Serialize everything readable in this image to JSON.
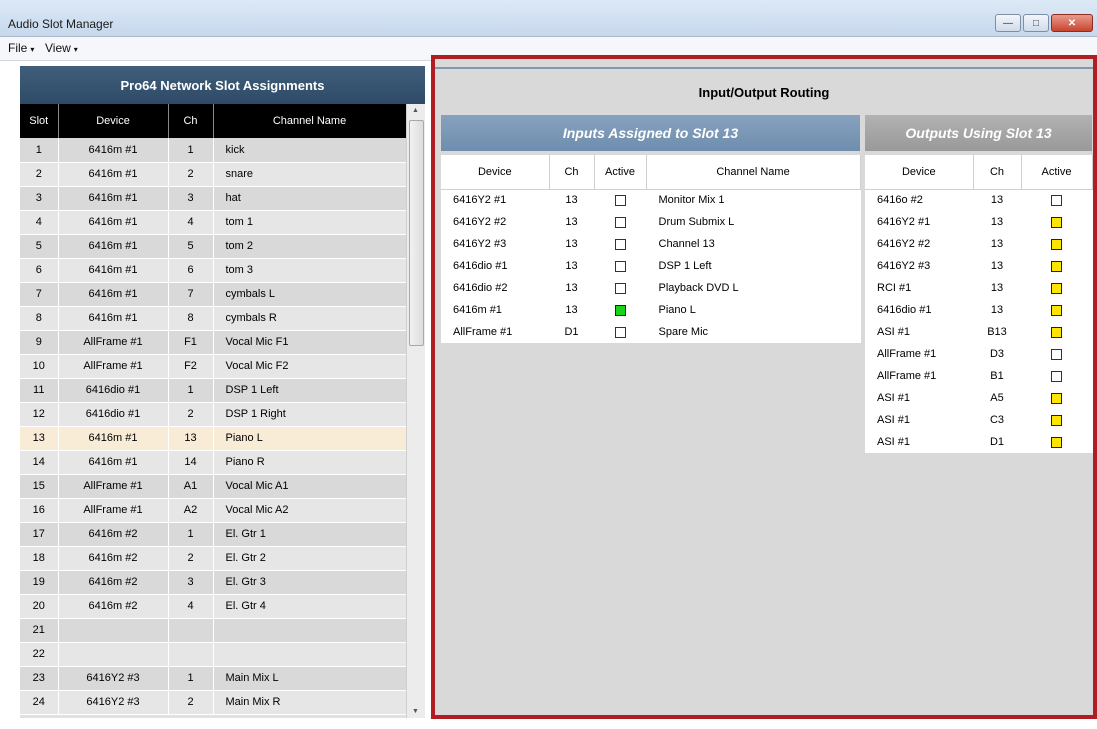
{
  "window": {
    "title": "Audio Slot Manager",
    "min": "—",
    "max": "□",
    "close": "✕"
  },
  "menu": [
    {
      "label": "File",
      "arrow": "▾"
    },
    {
      "label": "View",
      "arrow": "▾"
    }
  ],
  "slots": {
    "title": "Pro64 Network Slot Assignments",
    "columns": [
      "Slot",
      "Device",
      "Ch",
      "Channel Name"
    ],
    "rows": [
      {
        "slot": "1",
        "device": "6416m #1",
        "ch": "1",
        "name": "kick"
      },
      {
        "slot": "2",
        "device": "6416m #1",
        "ch": "2",
        "name": "snare"
      },
      {
        "slot": "3",
        "device": "6416m #1",
        "ch": "3",
        "name": "hat"
      },
      {
        "slot": "4",
        "device": "6416m #1",
        "ch": "4",
        "name": "tom 1"
      },
      {
        "slot": "5",
        "device": "6416m #1",
        "ch": "5",
        "name": "tom 2"
      },
      {
        "slot": "6",
        "device": "6416m #1",
        "ch": "6",
        "name": "tom 3"
      },
      {
        "slot": "7",
        "device": "6416m #1",
        "ch": "7",
        "name": "cymbals L"
      },
      {
        "slot": "8",
        "device": "6416m #1",
        "ch": "8",
        "name": "cymbals R"
      },
      {
        "slot": "9",
        "device": "AllFrame #1",
        "ch": "F1",
        "name": "Vocal Mic F1"
      },
      {
        "slot": "10",
        "device": "AllFrame #1",
        "ch": "F2",
        "name": "Vocal Mic F2"
      },
      {
        "slot": "11",
        "device": "6416dio #1",
        "ch": "1",
        "name": "DSP 1 Left"
      },
      {
        "slot": "12",
        "device": "6416dio #1",
        "ch": "2",
        "name": "DSP 1 Right"
      },
      {
        "slot": "13",
        "device": "6416m #1",
        "ch": "13",
        "name": "Piano L"
      },
      {
        "slot": "14",
        "device": "6416m #1",
        "ch": "14",
        "name": "Piano R"
      },
      {
        "slot": "15",
        "device": "AllFrame #1",
        "ch": "A1",
        "name": "Vocal Mic A1"
      },
      {
        "slot": "16",
        "device": "AllFrame #1",
        "ch": "A2",
        "name": "Vocal Mic A2"
      },
      {
        "slot": "17",
        "device": "6416m #2",
        "ch": "1",
        "name": "El. Gtr 1"
      },
      {
        "slot": "18",
        "device": "6416m #2",
        "ch": "2",
        "name": "El. Gtr 2"
      },
      {
        "slot": "19",
        "device": "6416m #2",
        "ch": "3",
        "name": "El. Gtr 3"
      },
      {
        "slot": "20",
        "device": "6416m #2",
        "ch": "4",
        "name": "El. Gtr 4"
      },
      {
        "slot": "21",
        "device": "",
        "ch": "",
        "name": ""
      },
      {
        "slot": "22",
        "device": "",
        "ch": "",
        "name": ""
      },
      {
        "slot": "23",
        "device": "6416Y2 #3",
        "ch": "1",
        "name": "Main Mix L"
      },
      {
        "slot": "24",
        "device": "6416Y2 #3",
        "ch": "2",
        "name": "Main Mix R"
      }
    ],
    "selected_slot": "13"
  },
  "routing": {
    "title": "Input/Output Routing",
    "inputs": {
      "header": "Inputs Assigned to Slot 13",
      "columns": [
        "Device",
        "Ch",
        "Active",
        "Channel Name"
      ],
      "rows": [
        {
          "device": "6416Y2 #1",
          "ch": "13",
          "active": "off",
          "name": "Monitor Mix 1"
        },
        {
          "device": "6416Y2 #2",
          "ch": "13",
          "active": "off",
          "name": "Drum Submix L"
        },
        {
          "device": "6416Y2 #3",
          "ch": "13",
          "active": "off",
          "name": "Channel 13"
        },
        {
          "device": "6416dio #1",
          "ch": "13",
          "active": "off",
          "name": "DSP 1 Left"
        },
        {
          "device": "6416dio #2",
          "ch": "13",
          "active": "off",
          "name": "Playback DVD L"
        },
        {
          "device": "6416m #1",
          "ch": "13",
          "active": "green",
          "name": "Piano L"
        },
        {
          "device": "AllFrame #1",
          "ch": "D1",
          "active": "off",
          "name": "Spare Mic"
        }
      ]
    },
    "outputs": {
      "header": "Outputs Using Slot 13",
      "columns": [
        "Device",
        "Ch",
        "Active"
      ],
      "rows": [
        {
          "device": "6416o #2",
          "ch": "13",
          "active": "off"
        },
        {
          "device": "6416Y2 #1",
          "ch": "13",
          "active": "yellow"
        },
        {
          "device": "6416Y2 #2",
          "ch": "13",
          "active": "yellow"
        },
        {
          "device": "6416Y2 #3",
          "ch": "13",
          "active": "yellow"
        },
        {
          "device": "RCI #1",
          "ch": "13",
          "active": "yellow"
        },
        {
          "device": "6416dio #1",
          "ch": "13",
          "active": "yellow"
        },
        {
          "device": "ASI #1",
          "ch": "B13",
          "active": "yellow"
        },
        {
          "device": "AllFrame #1",
          "ch": "D3",
          "active": "off"
        },
        {
          "device": "AllFrame #1",
          "ch": "B1",
          "active": "off"
        },
        {
          "device": "ASI #1",
          "ch": "A5",
          "active": "yellow"
        },
        {
          "device": "ASI #1",
          "ch": "C3",
          "active": "yellow"
        },
        {
          "device": "ASI #1",
          "ch": "D1",
          "active": "yellow"
        }
      ]
    }
  },
  "colors": {
    "highlight_border": "#b01e23",
    "active_green": "#18d418",
    "active_yellow": "#ffe400",
    "selected_row": "#f8ecd7"
  }
}
